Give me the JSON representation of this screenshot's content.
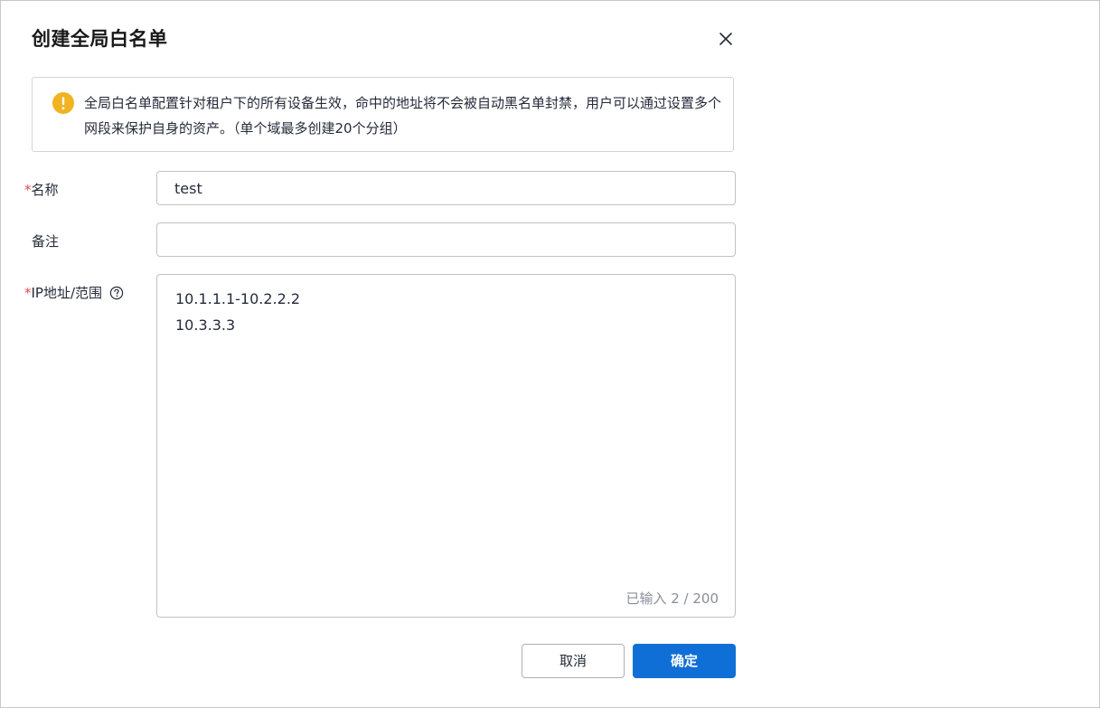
{
  "dialog": {
    "title": "创建全局白名单",
    "notice": "全局白名单配置针对租户下的所有设备生效，命中的地址将不会被自动黑名单封禁，用户可以通过设置多个网段来保护自身的资产。（单个域最多创建20个分组）"
  },
  "form": {
    "required_mark": "*",
    "name": {
      "label": "名称",
      "value": "test"
    },
    "remark": {
      "label": "备注",
      "value": ""
    },
    "ip": {
      "label": "IP地址/范围",
      "lines": [
        "10.1.1.1-10.2.2.2",
        "10.3.3.3"
      ],
      "counter": "已输入 2 / 200"
    }
  },
  "buttons": {
    "cancel": "取消",
    "ok": "确定"
  },
  "colors": {
    "primary": "#0f6fd6",
    "warning": "#f0b321",
    "required": "#e54545"
  },
  "icons": {
    "close": "close-icon",
    "warning": "warning-icon",
    "help": "help-icon"
  }
}
